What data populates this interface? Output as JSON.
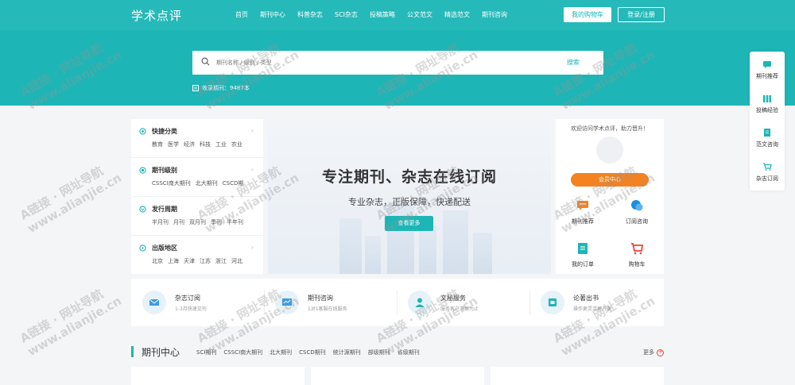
{
  "header": {
    "logo": "学术点评",
    "nav": [
      "首页",
      "期刊中心",
      "科普杂志",
      "SCI杂志",
      "投稿策略",
      "公文范文",
      "精选范文",
      "期刊咨询"
    ],
    "cart_label": "我的购物车",
    "login_label": "登录/注册"
  },
  "search": {
    "placeholder": "期刊名称 / 级别 / 类型",
    "button": "搜索",
    "count_text": "收录期刊：9487本"
  },
  "categories": [
    {
      "title": "快捷分类",
      "items": [
        "教育",
        "医学",
        "经济",
        "科技",
        "工业",
        "农业"
      ]
    },
    {
      "title": "期刊级别",
      "items": [
        "CSSCI南大期刊",
        "北大期刊",
        "CSCD期"
      ]
    },
    {
      "title": "发行周期",
      "items": [
        "半月刊",
        "月刊",
        "双月刊",
        "季刊",
        "半年刊"
      ]
    },
    {
      "title": "出版地区",
      "items": [
        "北京",
        "上海",
        "天津",
        "江苏",
        "浙江",
        "河北"
      ]
    }
  ],
  "banner": {
    "title": "专注期刊、杂志在线订阅",
    "subtitle": "专业杂志，正版保障，快递配送",
    "button": "查看更多"
  },
  "user": {
    "welcome": "欢迎访问学术点评，助力晋升！",
    "member_button": "会员中心",
    "links": [
      "期刊推荐",
      "订阅咨询",
      "我的订单",
      "购物车"
    ]
  },
  "services": [
    {
      "name": "杂志订阅",
      "desc": "1-3月快速见刊"
    },
    {
      "name": "期刊咨询",
      "desc": "1对1客服在线服务"
    },
    {
      "name": "文秘服务",
      "desc": "服务客户满意为止"
    },
    {
      "name": "论著出书",
      "desc": "操作更灵活更方便"
    }
  ],
  "journal_center": {
    "title": "期刊中心",
    "tabs": [
      "SCI期刊",
      "CSSCI南大期刊",
      "北大期刊",
      "CSCD期刊",
      "统计源期刊",
      "部级期刊",
      "省级期刊"
    ],
    "more": "更多"
  },
  "right_toolbar": [
    "期刊推荐",
    "投稿经验",
    "范文咨询",
    "杂志订阅"
  ],
  "watermark": {
    "line1": "A链接 · 网址导航",
    "line2": "www.alianjie.cn"
  },
  "colors": {
    "primary": "#1eb5b6",
    "orange": "#f58220",
    "red": "#e8463b"
  }
}
